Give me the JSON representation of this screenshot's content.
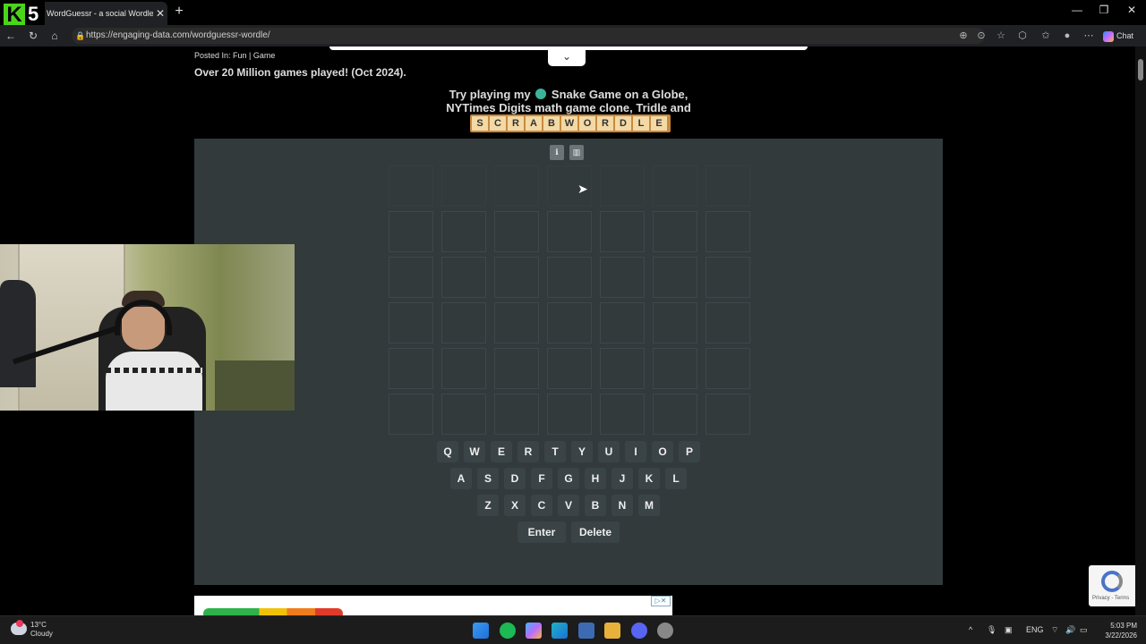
{
  "browser": {
    "tab_title": "WordGuessr - a social Wordle unli",
    "url": "https://engaging-data.com/wordguessr-wordle/",
    "chat_label": "Chat",
    "logo_number": "5"
  },
  "page": {
    "posted_prefix": "Posted In:",
    "posted_links": "Fun | Game",
    "headline": "Over 20 Million games played! (Oct 2024).",
    "promo_line1_a": "Try playing my",
    "promo_line1_b": "Snake Game on a Globe,",
    "promo_line2": "NYTimes Digits math game clone, Tridle and",
    "scrabwordle": [
      "S",
      "C",
      "R",
      "A",
      "B",
      "W",
      "O",
      "R",
      "D",
      "L",
      "E"
    ]
  },
  "game": {
    "rows": 6,
    "cols": 7,
    "keyboard": {
      "row1": [
        "Q",
        "W",
        "E",
        "R",
        "T",
        "Y",
        "U",
        "I",
        "O",
        "P"
      ],
      "row2": [
        "A",
        "S",
        "D",
        "F",
        "G",
        "H",
        "J",
        "K",
        "L"
      ],
      "row3": [
        "Z",
        "X",
        "C",
        "V",
        "B",
        "N",
        "M"
      ],
      "actions": [
        "Enter",
        "Delete"
      ]
    }
  },
  "recaptcha": {
    "text": "Privacy - Terms"
  },
  "taskbar": {
    "temp": "13°C",
    "condition": "Cloudy",
    "lang": "ENG",
    "time": "5:03 PM",
    "date": "3/22/2026"
  },
  "colors": {
    "game_bg": "#323a3c",
    "key_bg": "#3a4345",
    "tile_bg": "#f3d9a5",
    "logo_green": "#4bd41c"
  }
}
